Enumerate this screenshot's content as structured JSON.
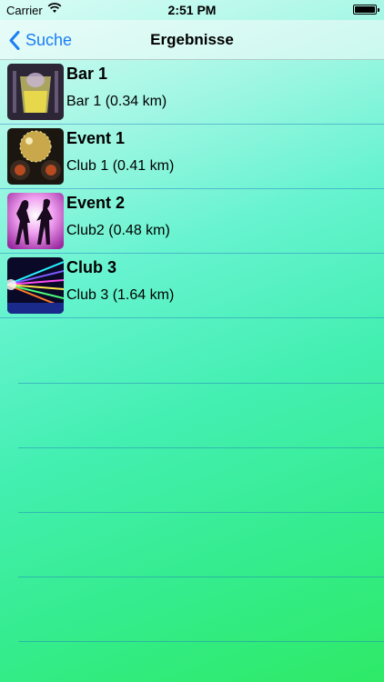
{
  "status": {
    "carrier": "Carrier",
    "time": "2:51 PM"
  },
  "nav": {
    "back_label": "Suche",
    "title": "Ergebnisse"
  },
  "items": [
    {
      "name": "Bar 1",
      "detail": "Bar 1 (0.34 km)",
      "icon": "bar-photo"
    },
    {
      "name": "Event 1",
      "detail": "Club 1 (0.41 km)",
      "icon": "disco-ball-photo"
    },
    {
      "name": "Event 2",
      "detail": "Club2 (0.48 km)",
      "icon": "dancers-photo"
    },
    {
      "name": "Club 3",
      "detail": "Club 3 (1.64 km)",
      "icon": "laser-photo"
    }
  ],
  "colors": {
    "tint": "#1a7ef5",
    "separator": "#1e78be"
  }
}
